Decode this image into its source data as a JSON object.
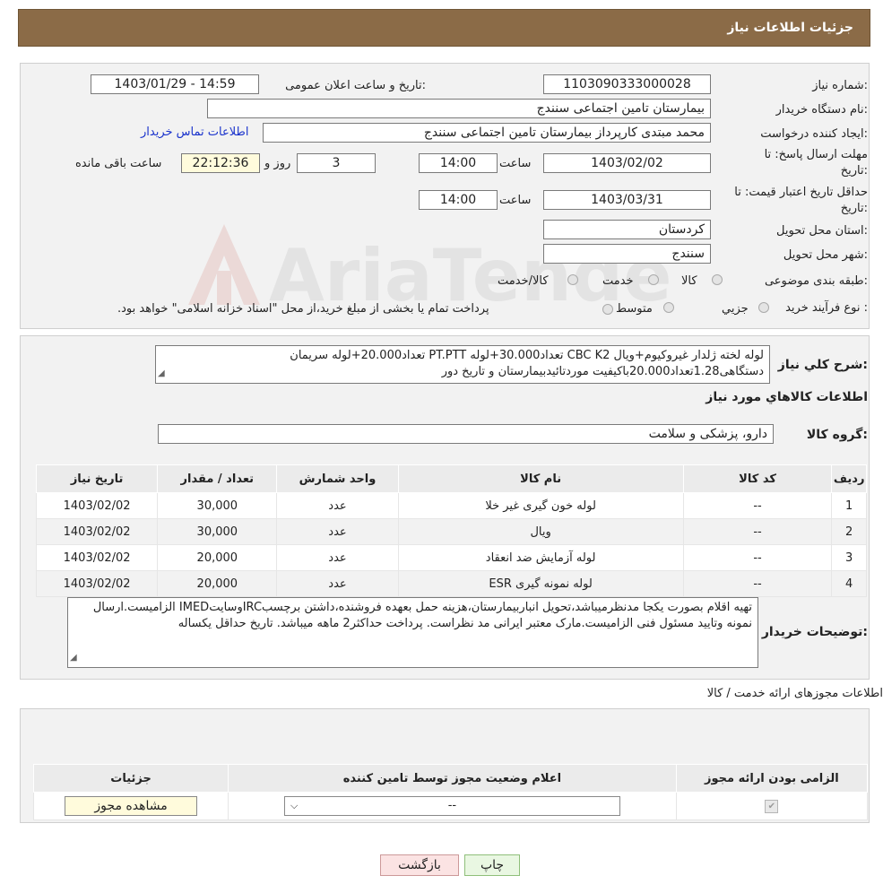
{
  "header": {
    "title": "جزئیات اطلاعات نیاز"
  },
  "form": {
    "need_number_label": "شماره نیاز:",
    "need_number": "1103090333000028",
    "announce_label": "تاریخ و ساعت اعلان عمومی:",
    "announce_value": "1403/01/29 - 14:59",
    "buyer_label": "نام دستگاه خریدار:",
    "buyer_value": "بیمارستان تامین اجتماعی سنندج",
    "creator_label": "ایجاد کننده درخواست:",
    "creator_value": "محمد مبتدی کارپرداز بیمارستان تامین اجتماعی سنندج",
    "contact_link": "اطلاعات تماس خریدار",
    "deadline_label_1": "مهلت ارسال پاسخ: تا",
    "deadline_label_2": "تاریخ:",
    "deadline_date": "1403/02/02",
    "time_label": "ساعت",
    "deadline_time": "14:00",
    "days_value": "3",
    "days_label": "روز و",
    "remaining_time": "22:12:36",
    "remaining_label": "ساعت باقی مانده",
    "validity_label_1": "حداقل تاریخ اعتبار قیمت: تا",
    "validity_label_2": "تاریخ:",
    "validity_date": "1403/03/31",
    "validity_time": "14:00",
    "province_label": "استان محل تحویل:",
    "province_value": "کردستان",
    "city_label": "شهر محل تحویل:",
    "city_value": "سنندج",
    "category_label": "طبقه بندی موضوعی:",
    "category_options": [
      "کالا",
      "خدمت",
      "کالا/خدمت"
    ],
    "process_label": "نوع فرآیند خرید :",
    "process_options": [
      "جزیي",
      "متوسط"
    ],
    "process_note": "پرداخت تمام یا بخشی از مبلغ خرید،از محل \"اسناد خزانه اسلامی\" خواهد بود."
  },
  "summary": {
    "label": "شرح کلي نياز:",
    "text": "لوله لخته ژلدار غیروکیوم+ویال CBC K2 تعداد30.000+لوله PT.PTT تعداد20.000+لوله سریمان دستگاهی1.28تعداد20.000باکیفیت موردتائیدبیمارستان و تاریخ دور",
    "goods_title": "اطلاعات کالاهاي مورد نياز",
    "group_label": "گروه کالا:",
    "group_value": "دارو، پزشکی و سلامت"
  },
  "items_table": {
    "headers": [
      "ردیف",
      "کد کالا",
      "نام کالا",
      "واحد شمارش",
      "تعداد / مقدار",
      "تاریخ نیاز"
    ],
    "rows": [
      [
        "1",
        "--",
        "لوله خون گیری غیر خلا",
        "عدد",
        "30,000",
        "1403/02/02"
      ],
      [
        "2",
        "--",
        "ویال",
        "عدد",
        "30,000",
        "1403/02/02"
      ],
      [
        "3",
        "--",
        "لوله آزمایش ضد انعقاد",
        "عدد",
        "20,000",
        "1403/02/02"
      ],
      [
        "4",
        "--",
        "لوله نمونه گیری ESR",
        "عدد",
        "20,000",
        "1403/02/02"
      ]
    ]
  },
  "buyer_notes": {
    "label": "توضیحات خریدار:",
    "text": "تهیه اقلام بصورت یکجا مدنظرمیباشد،تحویل انباربیمارستان،هزینه حمل بعهده فروشنده،داشتن برچسبIRCوسایتIMED الزامیست.ارسال نمونه وتایید مسئول فنی الزامیست.مارک معتبر ایرانی مد نظراست. پرداخت حداکثر2 ماهه میباشد. تاریخ حداقل یکساله"
  },
  "permits": {
    "title": "اطلاعات مجوزهای ارائه خدمت / کالا",
    "headers": [
      "الزامی بودن ارائه مجوز",
      "اعلام وضعیت مجوز توسط تامین کننده",
      "جزئیات"
    ],
    "select_value": "--",
    "view_button": "مشاهده مجوز"
  },
  "buttons": {
    "print": "چاپ",
    "back": "بازگشت"
  },
  "watermark": {
    "text": "AriaTender.neT"
  }
}
